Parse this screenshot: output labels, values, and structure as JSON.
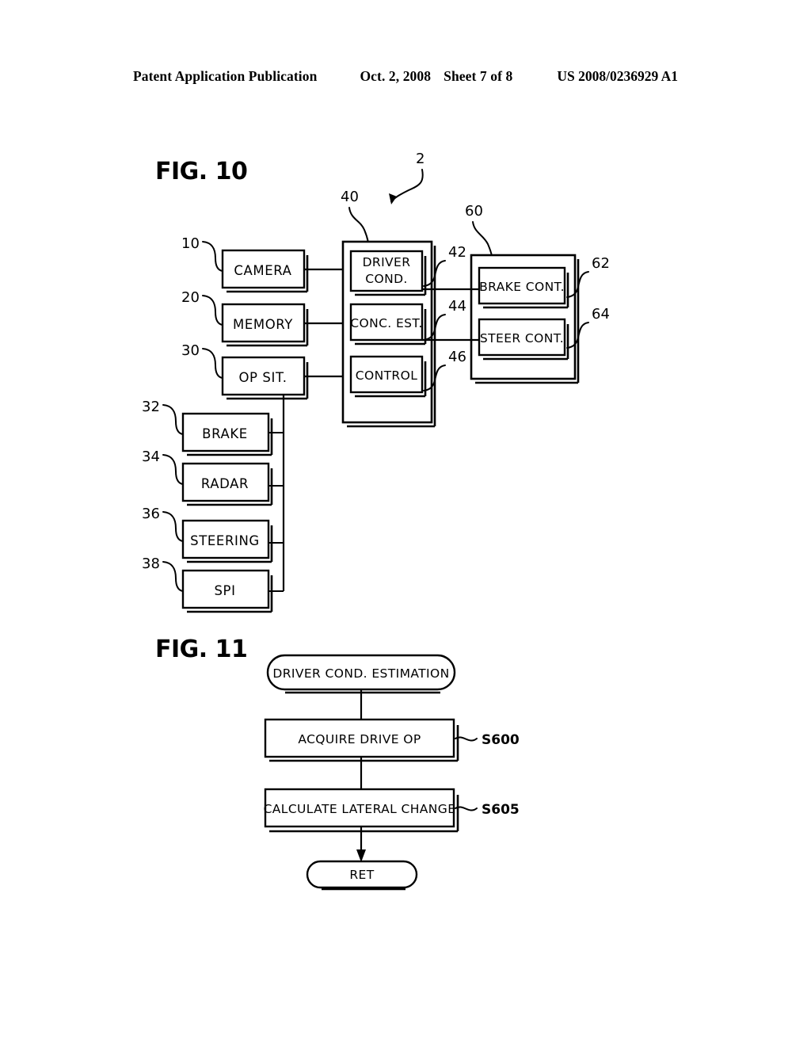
{
  "header": {
    "publication": "Patent Application Publication",
    "date": "Oct. 2, 2008",
    "sheet": "Sheet 7 of 8",
    "number": "US 2008/0236929 A1"
  },
  "fig10": {
    "title": "FIG. 10",
    "system_ref": "2",
    "left_blocks": [
      {
        "ref": "10",
        "label": "CAMERA"
      },
      {
        "ref": "20",
        "label": "MEMORY"
      },
      {
        "ref": "30",
        "label": "OP SIT."
      }
    ],
    "lower_blocks": [
      {
        "ref": "32",
        "label": "BRAKE"
      },
      {
        "ref": "34",
        "label": "RADAR"
      },
      {
        "ref": "36",
        "label": "STEERING"
      },
      {
        "ref": "38",
        "label": "SPI"
      }
    ],
    "ecu": {
      "ref": "40",
      "blocks": [
        {
          "ref": "42",
          "label_line1": "DRIVER",
          "label_line2": "COND."
        },
        {
          "ref": "44",
          "label_line1": "CONC.  EST.",
          "label_line2": ""
        },
        {
          "ref": "46",
          "label_line1": "CONTROL",
          "label_line2": ""
        }
      ]
    },
    "actuator": {
      "ref": "60",
      "blocks": [
        {
          "ref": "62",
          "label": "BRAKE CONT."
        },
        {
          "ref": "64",
          "label": "STEER CONT."
        }
      ]
    }
  },
  "fig11": {
    "title": "FIG. 11",
    "start_label": "DRIVER COND.  ESTIMATION",
    "steps": [
      {
        "id": "S600",
        "label": "ACQUIRE DRIVE OP"
      },
      {
        "id": "S605",
        "label": "CALCULATE LATERAL CHANGE"
      }
    ],
    "end_label": "RET"
  },
  "colors": {
    "ink": "#000000",
    "paper": "#ffffff"
  }
}
